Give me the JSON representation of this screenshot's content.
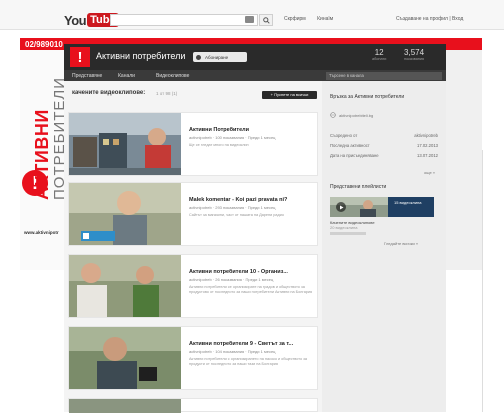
{
  "header": {
    "logo_you": "You",
    "logo_tube": "Tube",
    "search_icon": "search-icon",
    "links": [
      "Скрфирм",
      "Кинаїм"
    ],
    "right_links": "Създаване на профил | Вход"
  },
  "phone": "02/989010",
  "brand": {
    "mark": "!",
    "text_main": "АКТИВНИ",
    "text_sub": "ПОТРЕБИТЕЛИ",
    "url": "www.aktivnipotr"
  },
  "channel": {
    "title": "Активни потребители",
    "subscribe_label": "Абониране",
    "stats": [
      {
        "num": "12",
        "label": "абонати"
      },
      {
        "num": "3,574",
        "label": "показвания"
      }
    ],
    "nav": [
      "Представяне",
      "Канали",
      "Видеоклипове"
    ],
    "search_placeholder": "Търсене в канала"
  },
  "main": {
    "section_title": "качените видеоклипове:",
    "section_date": "1 от 98 (1)",
    "subscribe_mini": "+ Пуснете на всички",
    "videos": [
      {
        "title": "Активни Потребители",
        "meta": "activnipotreb · 100 показвания · Преди 1 месец",
        "desc": "Ще се гледат много на видеоклип"
      },
      {
        "title": "Malek komentar - Koi pazi pravata ni?",
        "meta": "activnipotreb · 293 показвания · Преди 1 месец",
        "desc": "Сайтът за магазини, част от нашата на Дарени радио"
      },
      {
        "title": "Активни потребители 10 - Организ...",
        "meta": "activnipotreb · 26 показвания · Преди 1 месец",
        "desc": "Активни потребители се организирате на градов и обществото за продуктово от последното за наши потребители Активни на Болгария"
      },
      {
        "title": "Активни потребители 9 - Светът за т...",
        "meta": "activnipotreb · 104 показвания · Преди 1 месец",
        "desc": "Активни потребители с организирането на насоко и обществото за продукти от последното за наши тази на Болгария"
      }
    ]
  },
  "sidebar": {
    "heading": "Връзка за Активни потребители",
    "site": "aktivnipotrebiteli.bg",
    "rows": [
      {
        "label": "Съоредено от",
        "value": "aktivnipotreb"
      },
      {
        "label": "Последна активност",
        "value": "17.02.2013"
      },
      {
        "label": "Дата на присъединяване",
        "value": "13.07.2012"
      }
    ],
    "more1": "още »",
    "featured_heading": "Представени плейлисти",
    "featured_title": "Качените видеоклипове",
    "featured_sub": "20 видеоклипа",
    "featured_badge": "15 видеоклипа",
    "more2": "Гледайте всички »"
  }
}
